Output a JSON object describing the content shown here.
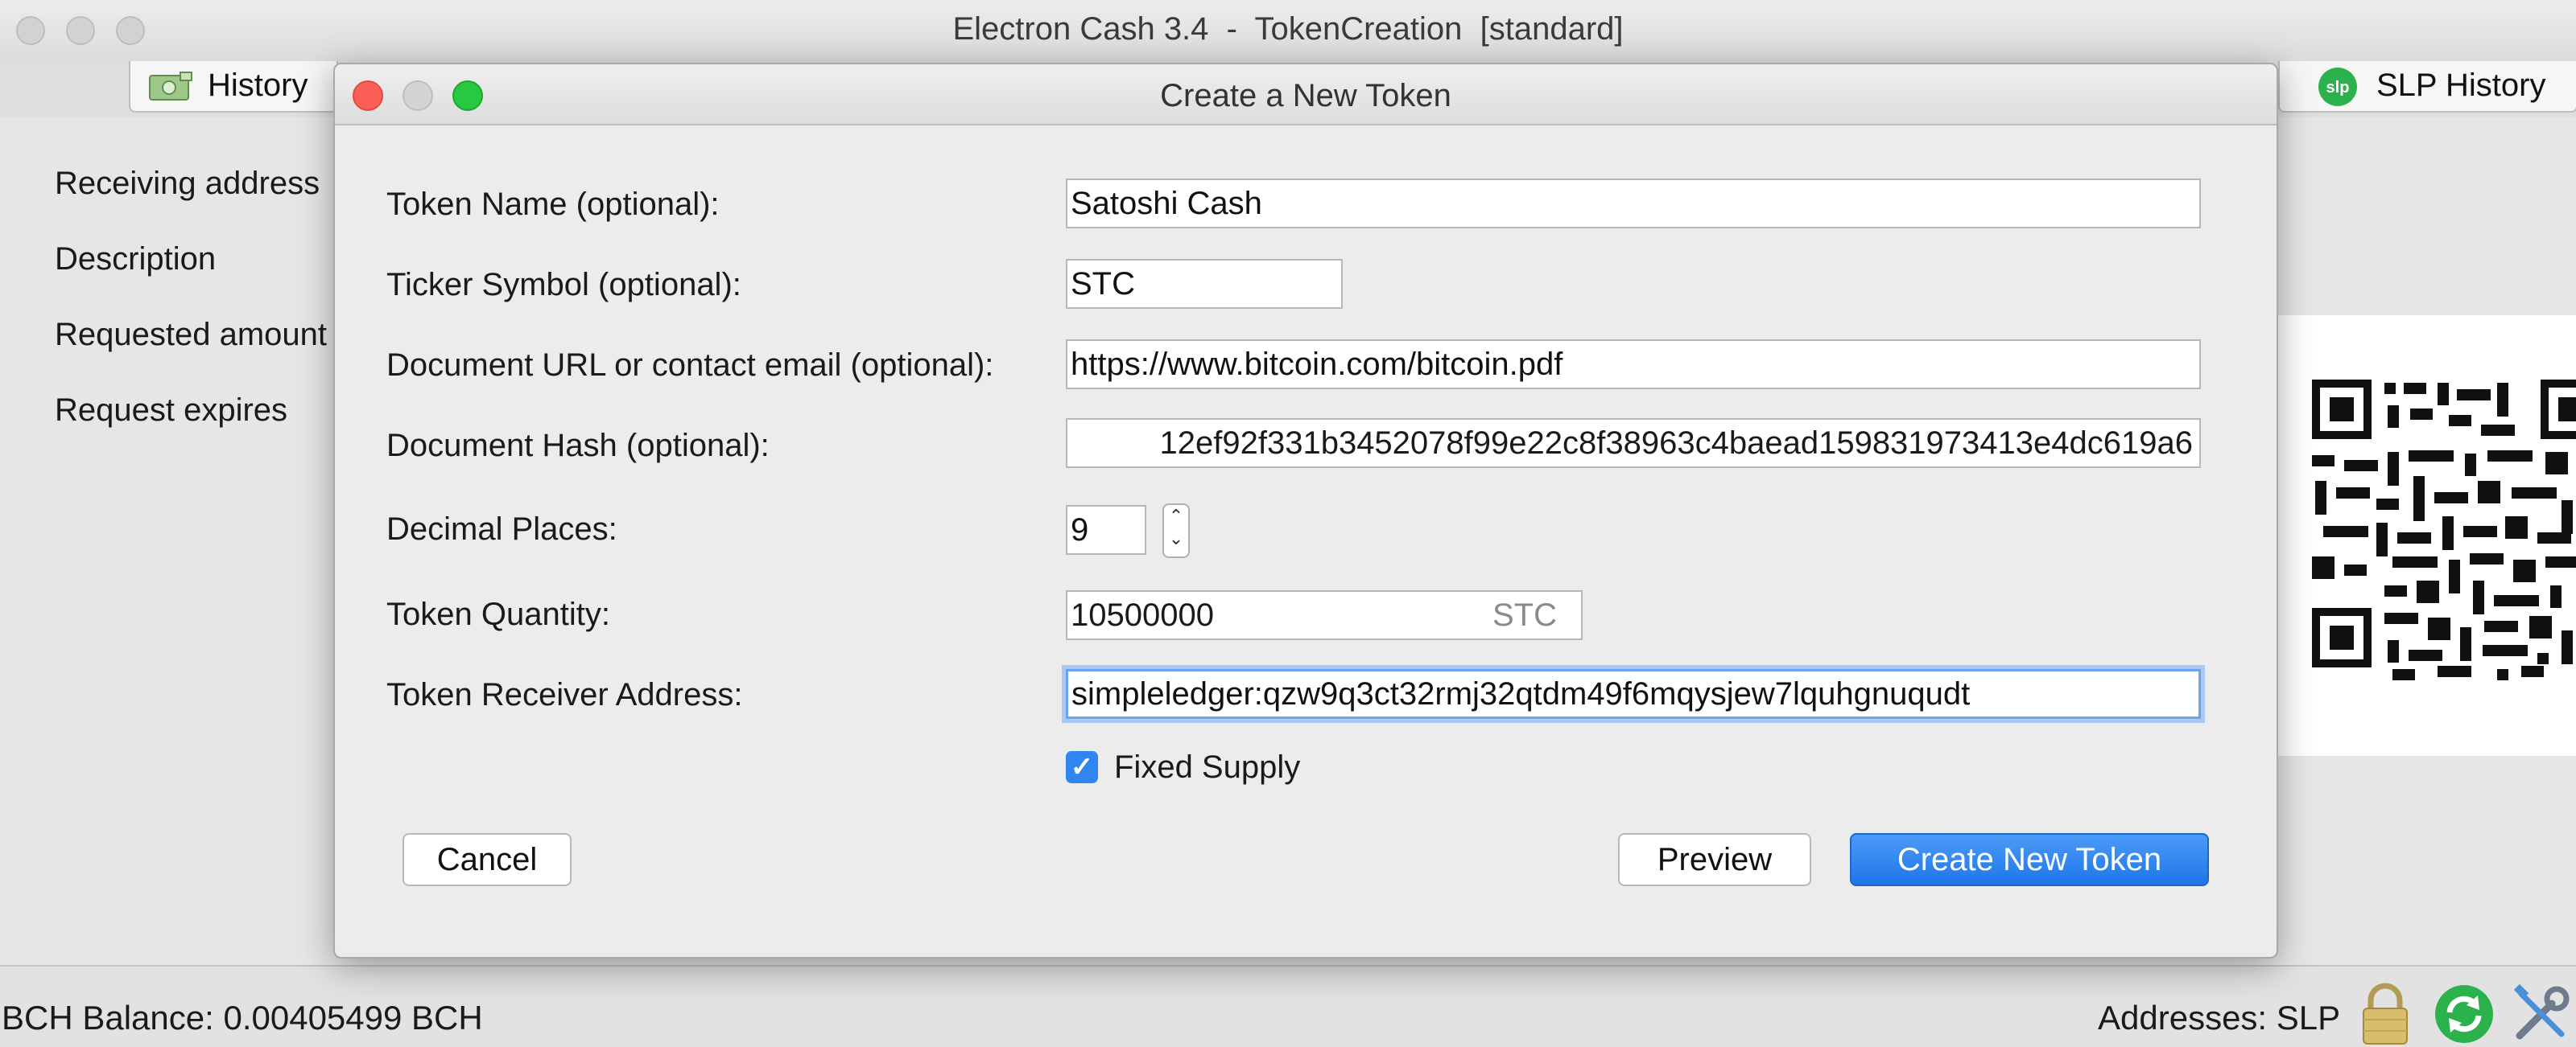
{
  "window": {
    "title": "Electron Cash 3.4  -  TokenCreation  [standard]"
  },
  "tabs": [
    {
      "label": "History",
      "icon": "history-icon"
    },
    {
      "label": "SLP History",
      "icon": "slp-icon"
    }
  ],
  "receive_form": {
    "labels": [
      "Receiving address",
      "Description",
      "Requested amount",
      "Request expires"
    ]
  },
  "dialog": {
    "title": "Create a New Token",
    "fields": {
      "token_name": {
        "label": "Token Name (optional):",
        "value": "Satoshi Cash"
      },
      "ticker": {
        "label": "Ticker Symbol (optional):",
        "value": "STC"
      },
      "doc_url": {
        "label": "Document URL or contact email (optional):",
        "value": "https://www.bitcoin.com/bitcoin.pdf"
      },
      "doc_hash": {
        "label": "Document Hash (optional):",
        "value": "12ef92f331b3452078f99e22c8f38963c4baead159831973413e4dc619a6"
      },
      "decimals": {
        "label": "Decimal Places:",
        "value": "9"
      },
      "quantity": {
        "label": "Token Quantity:",
        "value": "10500000",
        "unit": "STC"
      },
      "receiver": {
        "label": "Token Receiver Address:",
        "value": "simpleledger:qzw9q3ct32rmj32qtdm49f6mqysjew7lquhgnuqudt"
      }
    },
    "fixed_supply": {
      "label": "Fixed Supply",
      "checked": true
    },
    "buttons": {
      "cancel": "Cancel",
      "preview": "Preview",
      "create": "Create New Token"
    }
  },
  "status": {
    "balance": "BCH Balance: 0.00405499 BCH",
    "addresses": "Addresses: SLP"
  },
  "colors": {
    "accent": "#2f86f0",
    "close": "#fc5f57",
    "minimize": "#fdbc2e",
    "maximize": "#28c840",
    "slp_green": "#2bb24c"
  }
}
